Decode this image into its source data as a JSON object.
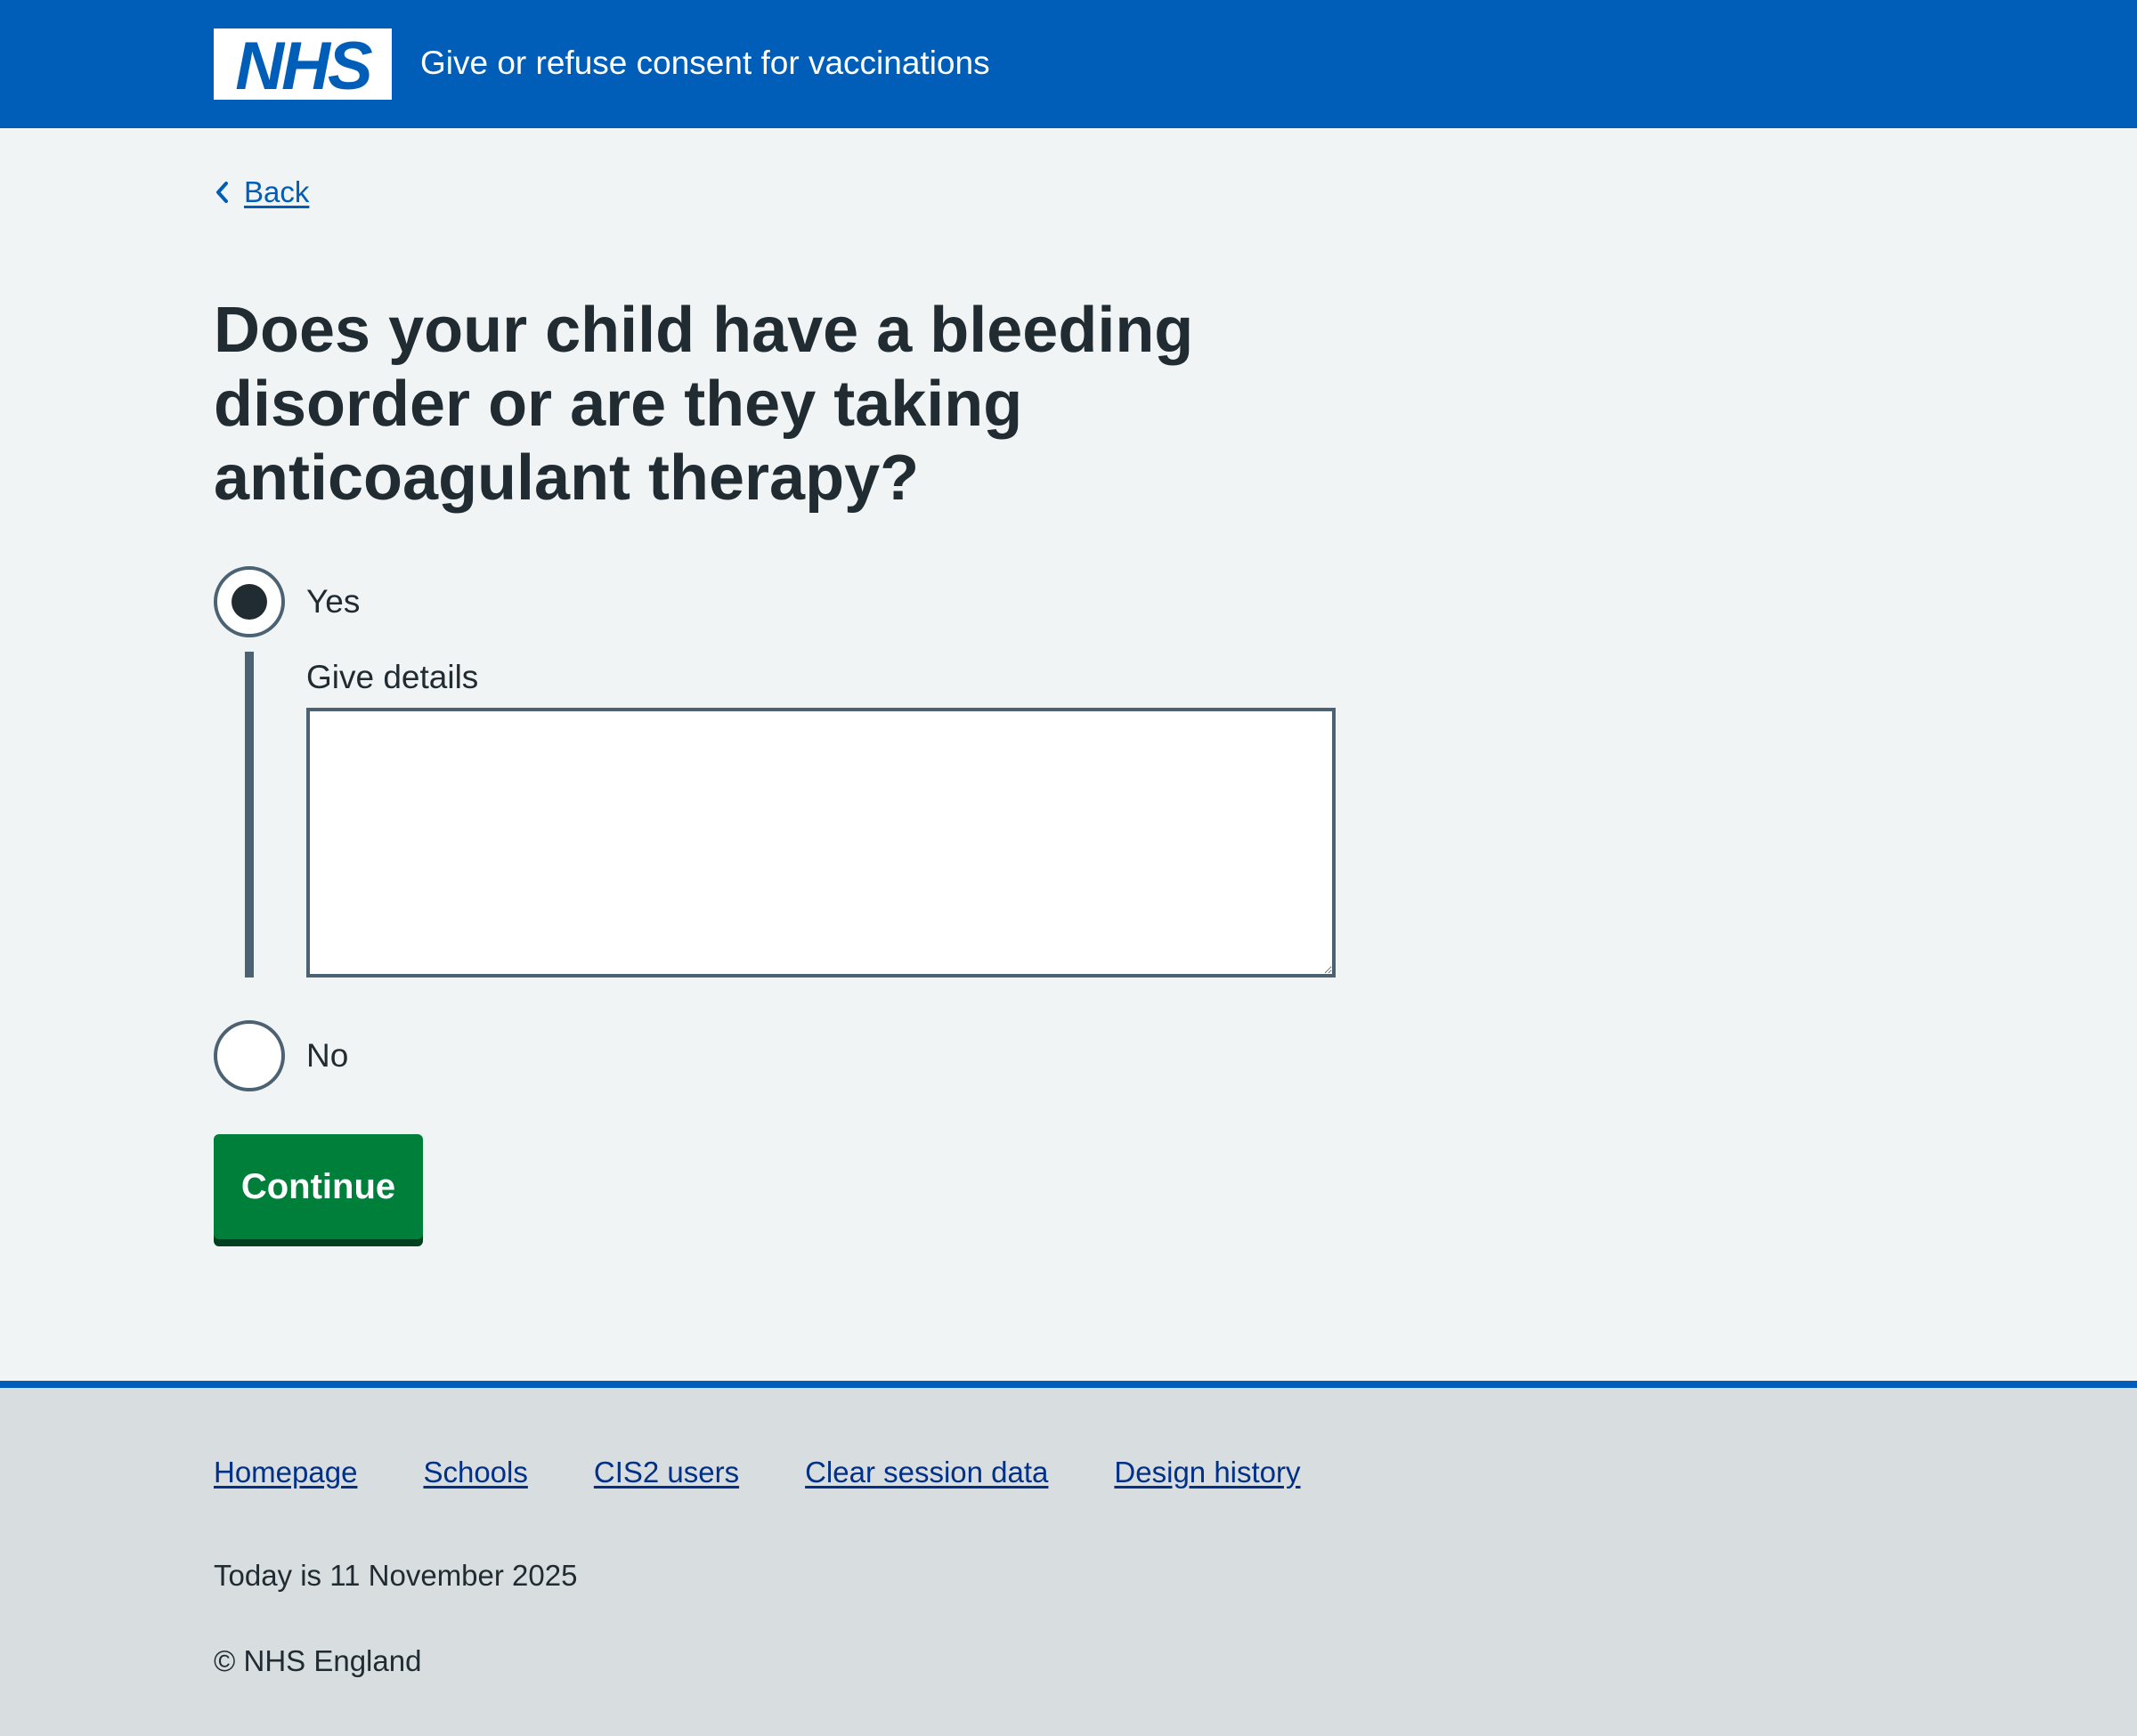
{
  "header": {
    "logo_text": "NHS",
    "service_name": "Give or refuse consent for vaccinations",
    "background_color": "#005eb8"
  },
  "back_link": {
    "label": "Back",
    "icon": "chevron-left-icon"
  },
  "question": {
    "title": "Does your child have a bleeding disorder or are they taking anticoagulant therapy?"
  },
  "options": {
    "yes": {
      "label": "Yes",
      "selected": true
    },
    "no": {
      "label": "No",
      "selected": false
    }
  },
  "details": {
    "label": "Give details",
    "value": ""
  },
  "continue_button": {
    "label": "Continue",
    "color": "#007f3b"
  },
  "footer": {
    "links": [
      "Homepage",
      "Schools",
      "CIS2 users",
      "Clear session data",
      "Design history"
    ],
    "date_text": "Today is 11 November 2025",
    "copyright": "© NHS England"
  }
}
